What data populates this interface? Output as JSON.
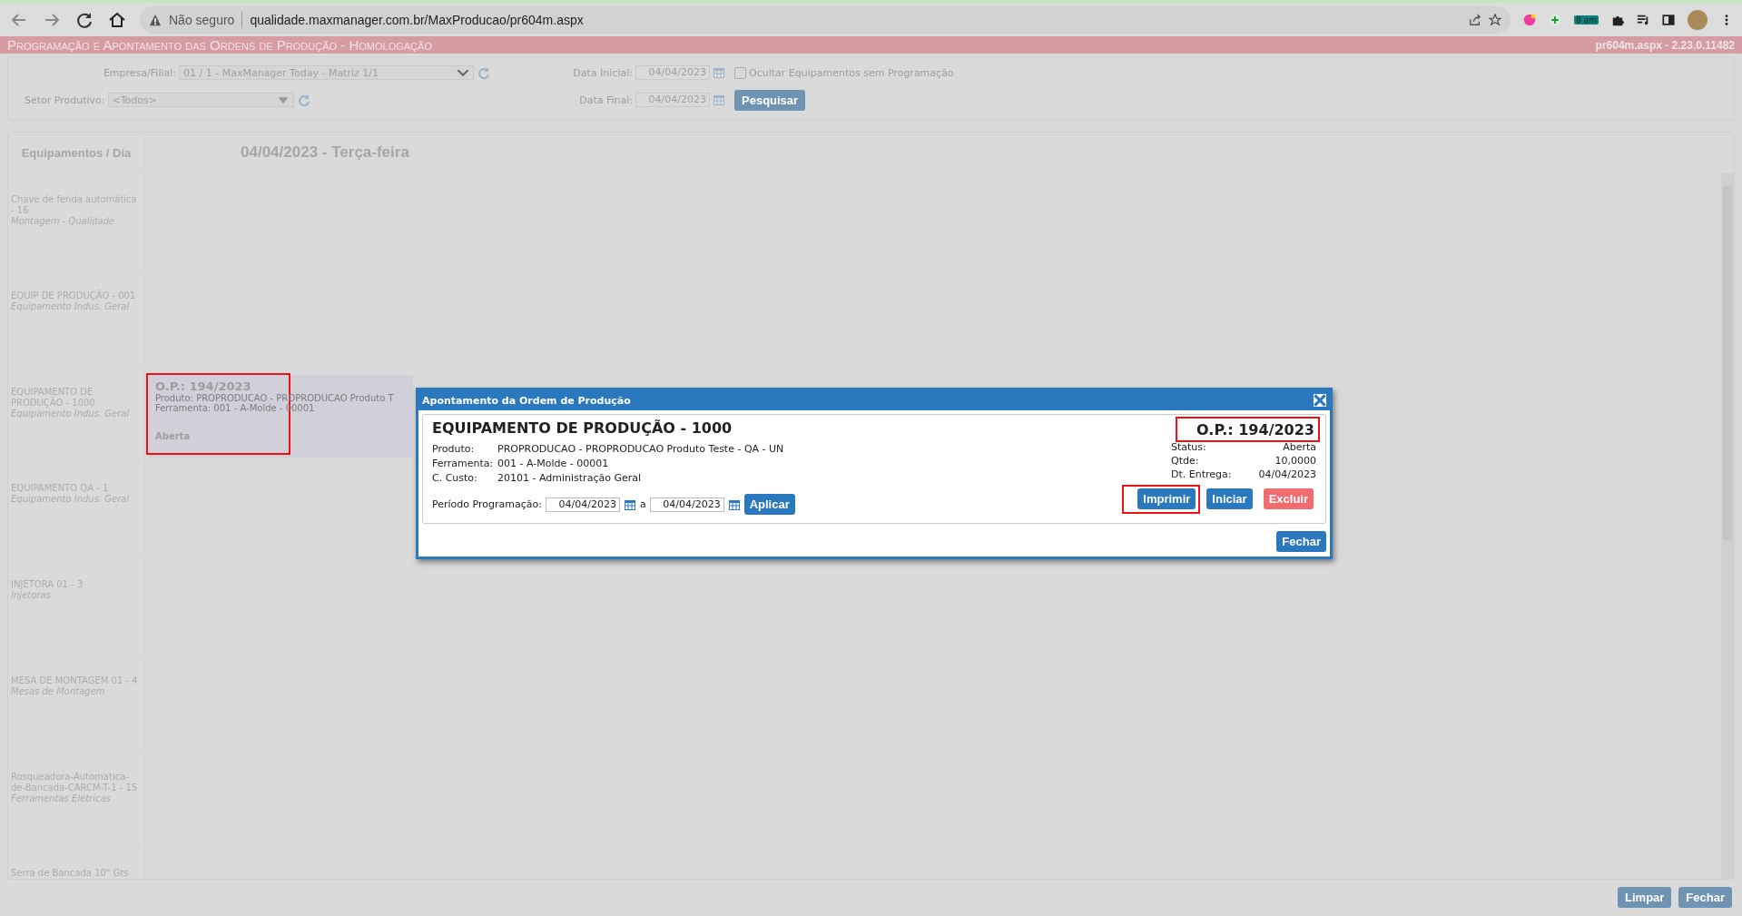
{
  "browser": {
    "security_label": "Não seguro",
    "url": "qualidade.maxmanager.com.br/MaxProducao/pr604m.aspx",
    "badge": "8 am"
  },
  "header": {
    "title": "Programação e Apontamento das Ordens de Produção  - Homologação",
    "version": "pr604m.aspx - 2.23.0.11482"
  },
  "filters": {
    "empresa_label": "Empresa/Filial:",
    "empresa_value": "01 / 1 - MaxManager Today - Matriz 1/1",
    "setor_label": "Setor Produtivo:",
    "setor_value": "<Todos>",
    "data_inicial_label": "Data Inicial:",
    "data_inicial_value": "04/04/2023",
    "data_final_label": "Data Final:",
    "data_final_value": "04/04/2023",
    "ocultar_label": "Ocultar Equipamentos sem Programação",
    "ocultar_checked": false,
    "search_button": "Pesquisar"
  },
  "schedule": {
    "column_header": "Equipamentos / Dia",
    "day_header": "04/04/2023 - Terça-feira",
    "rows": [
      {
        "name": "Chave de fenda automática - 16",
        "group": "Montagem - Qualidade"
      },
      {
        "name": "EQUIP DE PRODUÇÃO - 001",
        "group": "Equipamento Indus. Geral"
      },
      {
        "name": "EQUIPAMENTO DE PRODUÇÃO - 1000",
        "group": "Equipamento Indus. Geral",
        "event": {
          "title": "O.P.: 194/2023",
          "produto": "Produto: PROPRODUCAO - PROPRODUCAO Produto T",
          "ferramenta": "Ferramenta: 001 - A-Molde - 00001",
          "status": "Aberta",
          "highlighted": true
        }
      },
      {
        "name": "EQUIPAMENTO QA - 1",
        "group": "Equipamento Indus. Geral"
      },
      {
        "name": "INJETORA 01 - 3",
        "group": "Injetoras"
      },
      {
        "name": "MESA DE MONTAGEM 01 - 4",
        "group": "Mesas de Montagem"
      },
      {
        "name": "Rosqueadora-Automatica-de-Bancada-CARCM-T-1 - 15",
        "group": "Ferramentas Elétricas"
      },
      {
        "name": "Serra de Bancada 10\" Gts"
      }
    ]
  },
  "modal": {
    "title": "Apontamento da Ordem de Produção",
    "equipment": "EQUIPAMENTO DE PRODUÇÃO - 1000",
    "op": "O.P.: 194/2023",
    "op_highlighted": true,
    "fields": [
      {
        "label": "Produto:",
        "value": "PROPRODUCAO - PROPRODUCAO Produto Teste - QA - UN"
      },
      {
        "label": "Ferramenta:",
        "value": "001 - A-Molde - 00001"
      },
      {
        "label": "C. Custo:",
        "value": "20101 - Administração Geral"
      }
    ],
    "details": [
      {
        "label": "Status:",
        "value": "Aberta"
      },
      {
        "label": "Qtde:",
        "value": "10,0000"
      },
      {
        "label": "Dt. Entrega:",
        "value": "04/04/2023"
      }
    ],
    "period_label": "Período Programação:",
    "period_from": "04/04/2023",
    "period_separator": "a",
    "period_to": "04/04/2023",
    "apply_button": "Aplicar",
    "actions": [
      {
        "label": "Imprimir",
        "kind": "primary",
        "highlighted": true
      },
      {
        "label": "Iniciar",
        "kind": "primary",
        "highlighted": false
      },
      {
        "label": "Excluir",
        "kind": "danger",
        "highlighted": false
      }
    ],
    "close_button": "Fechar"
  },
  "footer": {
    "buttons": [
      "Limpar",
      "Fechar"
    ]
  }
}
